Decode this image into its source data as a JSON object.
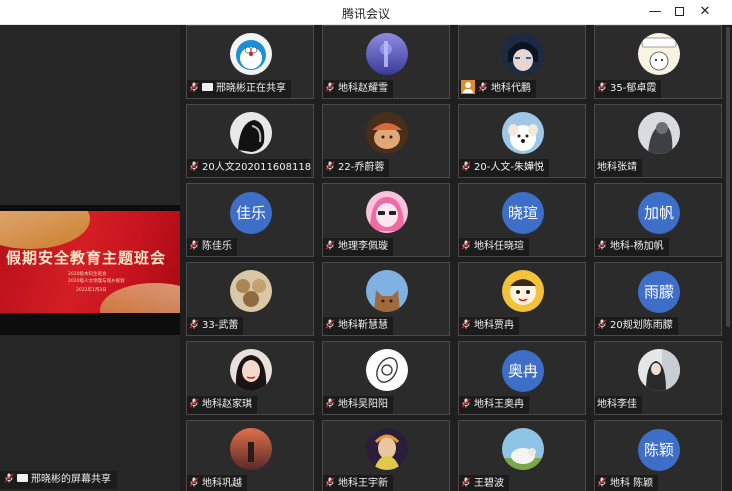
{
  "window": {
    "title": "腾讯会议",
    "minimize_glyph": "—",
    "close_glyph": "✕"
  },
  "share": {
    "label": "邢晓彬的屏幕共享",
    "slide_title": "假期安全教育主题班会",
    "slide_lines": [
      "2020级本科生班会",
      "2020级人文地理与城乡规划",
      "2022年1月2日"
    ]
  },
  "participants": [
    {
      "name": "邢晓彬正在共享",
      "sharing": true,
      "avatar": "doraemon"
    },
    {
      "name": "地科赵耀雪",
      "avatar": "purple-city"
    },
    {
      "name": "地科代鹏",
      "host": true,
      "avatar": "anime-boy"
    },
    {
      "name": "35-郁卓霞",
      "avatar": "smile-sticker"
    },
    {
      "name": "20人文202011608118...",
      "avatar": "dark-profile"
    },
    {
      "name": "22-乔蔚蓉",
      "avatar": "dog-hat"
    },
    {
      "name": "20-人文-朱嬅悦",
      "avatar": "white-dog"
    },
    {
      "name": "地科张靖",
      "no_mic": true,
      "avatar": "grey-bw"
    },
    {
      "name": "陈佳乐",
      "initials": "佳乐"
    },
    {
      "name": "地理李佩璇",
      "avatar": "pink-girl"
    },
    {
      "name": "地科任晓瑄",
      "initials": "晓瑄"
    },
    {
      "name": "地科-杨加帆",
      "initials": "加帆"
    },
    {
      "name": "33-武蕾",
      "avatar": "cat-group"
    },
    {
      "name": "地科靳慧慧",
      "avatar": "cat-sky"
    },
    {
      "name": "地科贾冉",
      "avatar": "cartoon-orange"
    },
    {
      "name": "20规划陈雨朦",
      "initials": "雨朦"
    },
    {
      "name": "地科赵家琪",
      "avatar": "girl-red"
    },
    {
      "name": "地科吴阳阳",
      "avatar": "astronaut"
    },
    {
      "name": "地科王奥冉",
      "initials": "奥冉"
    },
    {
      "name": "地科李佳",
      "no_mic": true,
      "avatar": "girl-window"
    },
    {
      "name": "地科巩越",
      "avatar": "orange-dusk"
    },
    {
      "name": "地科王宇新",
      "avatar": "neon-girl"
    },
    {
      "name": "王碧波",
      "avatar": "sheep"
    },
    {
      "name": "地科 陈颖",
      "initials": "陈颖"
    }
  ],
  "colors": {
    "initials_bg": "#3d6ec8",
    "host_badge": "#e08a2a",
    "muted_mic": "#c8232c"
  }
}
